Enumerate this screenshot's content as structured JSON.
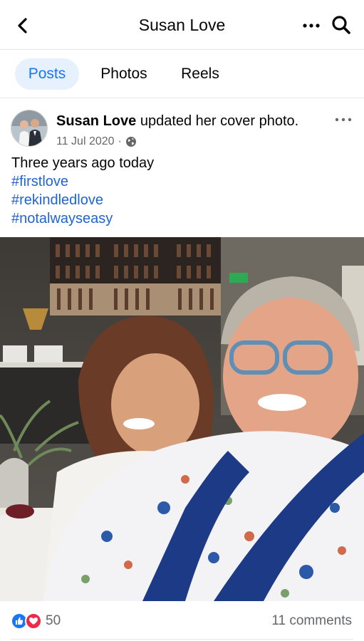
{
  "header": {
    "title": "Susan Love",
    "back_icon": "chevron-left-icon",
    "more_icon": "more-dots-icon",
    "search_icon": "search-icon"
  },
  "tabs": [
    {
      "label": "Posts",
      "active": true
    },
    {
      "label": "Photos",
      "active": false
    },
    {
      "label": "Reels",
      "active": false
    }
  ],
  "post": {
    "author": "Susan Love",
    "action": " updated her cover photo.",
    "date": "11 Jul 2020",
    "separator": "·",
    "audience_icon": "globe-icon",
    "text": "Three years ago today",
    "hashtags": [
      "#firstlove",
      "#rekindledlove",
      "#notalwayseasy"
    ],
    "reaction_count": "50",
    "comments": "11 comments"
  },
  "colors": {
    "accent": "#1877f2",
    "hashtag": "#1f63d4",
    "secondary_text": "#65676b",
    "love_reaction": "#f02849"
  }
}
